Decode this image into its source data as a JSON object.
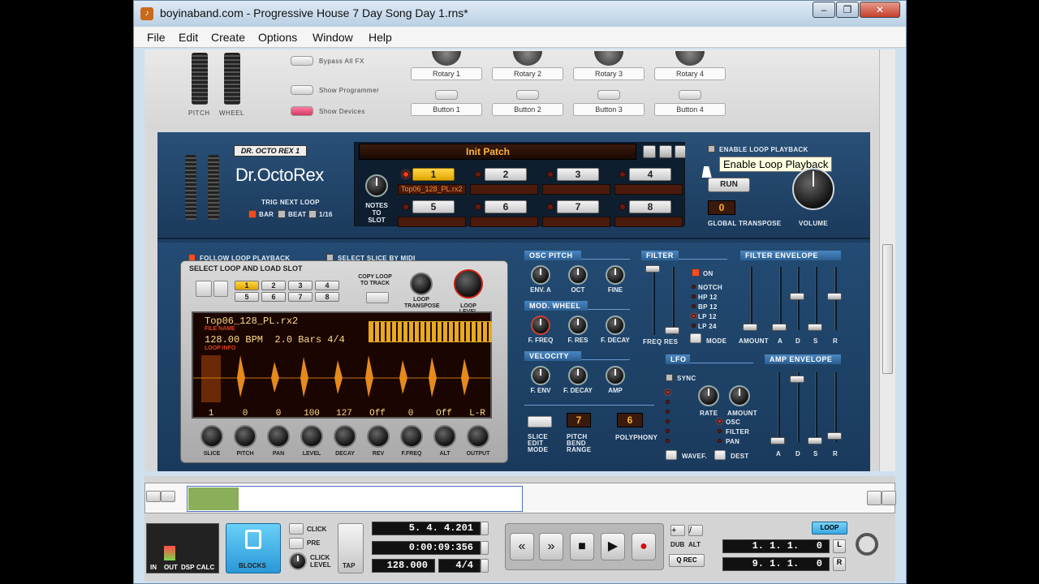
{
  "window": {
    "title": "boyinaband.com - Progressive House 7 Day Song Day 1.rns*",
    "icon": "reason-icon",
    "controls": {
      "minimize": "–",
      "maximize": "❐",
      "close": "✕"
    }
  },
  "menu": [
    "File",
    "Edit",
    "Create",
    "Options",
    "Window",
    "Help"
  ],
  "remote": {
    "pitch_label": "PITCH",
    "wheel_label": "WHEEL",
    "buttons": [
      "Bypass All FX",
      "Show Programmer",
      "Show Devices"
    ],
    "rotaries": [
      "Rotary 1",
      "Rotary 2",
      "Rotary 3",
      "Rotary 4"
    ],
    "assign_buttons": [
      "Button 1",
      "Button 2",
      "Button 3",
      "Button 4"
    ]
  },
  "rex": {
    "device_name": "DR. OCTO REX 1",
    "logo": "Dr.OctoRex",
    "trig_next_loop": "TRIG NEXT LOOP",
    "trig_opts": [
      "BAR",
      "BEAT",
      "1/16"
    ],
    "patch_name": "Init Patch",
    "notes_to_slot": "NOTES\nTO\nSLOT",
    "slots": [
      "1",
      "2",
      "3",
      "4",
      "5",
      "6",
      "7",
      "8"
    ],
    "slot1_file": "Top06_128_PL.rx2",
    "enable_loop": "ENABLE LOOP PLAYBACK",
    "tooltip": "Enable Loop Playback",
    "run": "RUN",
    "global_transpose_val": "0",
    "global_transpose": "GLOBAL TRANSPOSE",
    "volume": "VOLUME"
  },
  "prog": {
    "follow": "FOLLOW LOOP PLAYBACK",
    "select_slice": "SELECT SLICE BY MIDI",
    "select_loop": "SELECT LOOP AND LOAD SLOT",
    "copy_loop": "COPY LOOP\nTO TRACK",
    "loop_transpose": "LOOP\nTRANSPOSE",
    "loop_level": "LOOP LEVEL",
    "slots": [
      "1",
      "2",
      "3",
      "4",
      "5",
      "6",
      "7",
      "8"
    ],
    "filename": "Top06_128_PL.rx2",
    "file_name_lbl": "FILE NAME",
    "info": "128.00 BPM  2.0 Bars 4/4",
    "loop_info_lbl": "LOOP INFO",
    "values": [
      "1",
      "0",
      "0",
      "100",
      "127",
      "Off",
      "0",
      "Off",
      "L-R"
    ],
    "knob_labels": [
      "SLICE",
      "PITCH",
      "PAN",
      "LEVEL",
      "DECAY",
      "REV",
      "F.FREQ",
      "ALT",
      "OUTPUT"
    ],
    "osc_pitch": "OSC PITCH",
    "osc_knobs": [
      "ENV. A",
      "OCT",
      "FINE"
    ],
    "mod_wheel": "MOD. WHEEL",
    "mod_knobs": [
      "F. FREQ",
      "F. RES",
      "F. DECAY"
    ],
    "velocity": "VELOCITY",
    "vel_knobs": [
      "F. ENV",
      "F. DECAY",
      "AMP"
    ],
    "slice_edit_mode": "SLICE\nEDIT\nMODE",
    "pitch_bend_val": "7",
    "pitch_bend": "PITCH\nBEND\nRANGE",
    "polyphony_val": "6",
    "polyphony": "POLYPHONY",
    "filter": "FILTER",
    "filter_on": "ON",
    "filter_modes": [
      "NOTCH",
      "HP 12",
      "BP 12",
      "LP 12",
      "LP 24"
    ],
    "freq_res": "FREQ RES",
    "mode": "MODE",
    "filter_env": "FILTER ENVELOPE",
    "env_labels": [
      "AMOUNT",
      "A",
      "D",
      "S",
      "R"
    ],
    "lfo": "LFO",
    "sync": "SYNC",
    "rate": "RATE",
    "amount": "AMOUNT",
    "lfo_dest": [
      "OSC",
      "FILTER",
      "PAN"
    ],
    "waveform": "WAVEF.",
    "dest": "DEST",
    "amp_env": "AMP ENVELOPE",
    "amp_labels": [
      "A",
      "D",
      "S",
      "R"
    ]
  },
  "transport": {
    "meter_labels": [
      "IN",
      "OUT",
      "DSP",
      "CALC"
    ],
    "blocks": "BLOCKS",
    "click": "CLICK",
    "pre": "PRE",
    "click_level": "CLICK\nLEVEL",
    "tap": "TAP",
    "position": "5. 4. 4.201",
    "time": "0:00:09:356",
    "tempo": "128.000",
    "signature": "4/4",
    "dub": "DUB",
    "alt": "ALT",
    "qrec": "Q REC",
    "loop": "LOOP",
    "left_loc": "1. 1. 1.   0",
    "right_loc": "9. 1. 1.   0",
    "l": "L",
    "r": "R"
  },
  "colors": {
    "accent": "#ffd64a",
    "rack_blue": "#1d3e60",
    "led_red": "#ff3a1a",
    "waveform": "#e58a1c"
  }
}
